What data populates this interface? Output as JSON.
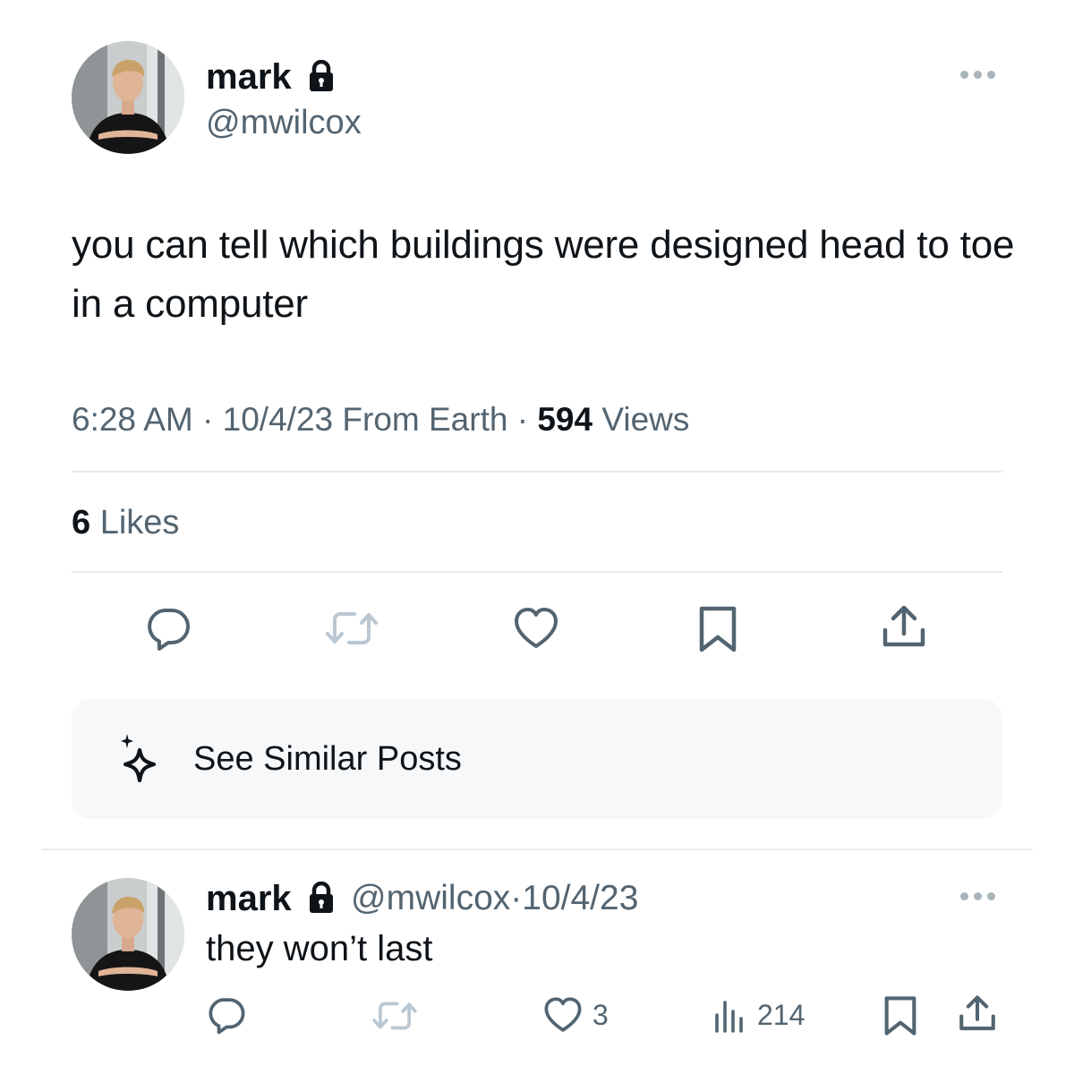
{
  "tweet": {
    "author": {
      "name": "mark",
      "handle": "@mwilcox",
      "avatar_icon": "profile-photo",
      "protected_icon": "lock-icon"
    },
    "more_icon": "more-icon",
    "text": "you can tell which buildings were designed head to toe in a computer",
    "meta": {
      "time": "6:28 AM",
      "sep1": "·",
      "date": "10/4/23",
      "source": "From Earth",
      "sep2": "·",
      "views_count": "594",
      "views_label": "Views"
    },
    "likes": {
      "count": "6",
      "label": "Likes"
    },
    "actions": [
      {
        "name": "reply",
        "icon": "comment-icon"
      },
      {
        "name": "repost",
        "icon": "repost-icon"
      },
      {
        "name": "like",
        "icon": "heart-icon"
      },
      {
        "name": "bookmark",
        "icon": "bookmark-icon"
      },
      {
        "name": "share",
        "icon": "share-icon"
      }
    ],
    "similar": {
      "label": "See Similar Posts",
      "icon": "sparkle-icon"
    }
  },
  "reply": {
    "author": {
      "name": "mark",
      "handle": "@mwilcox",
      "sep": "·",
      "date": "10/4/23",
      "avatar_icon": "profile-photo",
      "protected_icon": "lock-icon"
    },
    "text": "they won’t last",
    "more_icon": "more-icon",
    "actions": {
      "reply_icon": "comment-icon",
      "repost_icon": "repost-icon",
      "like_icon": "heart-icon",
      "like_count": "3",
      "views_icon": "views-icon",
      "views_count": "214",
      "bookmark_icon": "bookmark-icon",
      "share_icon": "share-icon"
    }
  },
  "colors": {
    "text": "#0f1419",
    "secondary": "#536471",
    "divider": "#e7ebee",
    "repost_disabled": "#b9c7d3",
    "card_bg": "#f6f8f9"
  }
}
